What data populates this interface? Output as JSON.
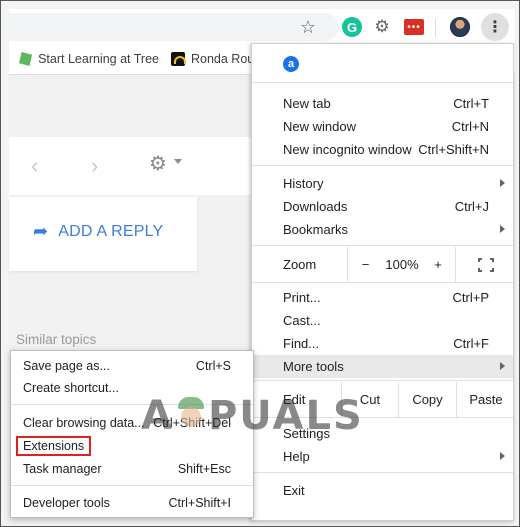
{
  "toolbar": {
    "icons": [
      "star-icon",
      "grammarly-icon",
      "extension-gear-icon",
      "red-extension-icon",
      "avatar",
      "kebab-menu-icon"
    ],
    "grammarly_letter": "G"
  },
  "bookmarks": [
    {
      "label": "Start Learning at Tree",
      "icon": "treehouse-icon"
    },
    {
      "label": "Ronda Rou",
      "icon": "ronda-icon"
    }
  ],
  "page": {
    "add_reply": "ADD A REPLY",
    "similar_topics": "Similar topics"
  },
  "menu": {
    "ext_icon_letter": "a",
    "new_tab": {
      "label": "New tab",
      "shortcut": "Ctrl+T"
    },
    "new_window": {
      "label": "New window",
      "shortcut": "Ctrl+N"
    },
    "new_incognito": {
      "label": "New incognito window",
      "shortcut": "Ctrl+Shift+N"
    },
    "history": {
      "label": "History"
    },
    "downloads": {
      "label": "Downloads",
      "shortcut": "Ctrl+J"
    },
    "bookmarks": {
      "label": "Bookmarks"
    },
    "zoom": {
      "label": "Zoom",
      "minus": "−",
      "value": "100%",
      "plus": "+"
    },
    "print": {
      "label": "Print...",
      "shortcut": "Ctrl+P"
    },
    "cast": {
      "label": "Cast..."
    },
    "find": {
      "label": "Find...",
      "shortcut": "Ctrl+F"
    },
    "more_tools": {
      "label": "More tools"
    },
    "edit": {
      "label": "Edit",
      "cut": "Cut",
      "copy": "Copy",
      "paste": "Paste"
    },
    "settings": {
      "label": "Settings"
    },
    "help": {
      "label": "Help"
    },
    "exit": {
      "label": "Exit"
    }
  },
  "submenu": {
    "save_page": {
      "label": "Save page as...",
      "shortcut": "Ctrl+S"
    },
    "create_shortcut": {
      "label": "Create shortcut..."
    },
    "clear_browsing": {
      "label": "Clear browsing data...",
      "shortcut": "Ctrl+Shift+Del"
    },
    "extensions": {
      "label": "Extensions"
    },
    "task_manager": {
      "label": "Task manager",
      "shortcut": "Shift+Esc"
    },
    "developer_tools": {
      "label": "Developer tools",
      "shortcut": "Ctrl+Shift+I"
    }
  },
  "watermark": {
    "left": "A",
    "right": "PUALS"
  },
  "colors": {
    "highlight_box": "#e0211f",
    "reply_blue": "#3b7ddd",
    "hover_row": "#e8e8e8"
  }
}
